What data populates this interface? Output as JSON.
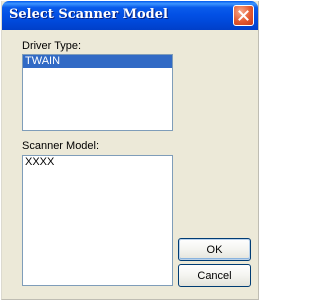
{
  "window": {
    "title": "Select Scanner Model"
  },
  "driver_type": {
    "label": "Driver Type:",
    "items": [
      "TWAIN"
    ],
    "selected_index": 0
  },
  "scanner_model": {
    "label": "Scanner Model:",
    "items": [
      "XXXX"
    ]
  },
  "buttons": {
    "ok_label": "OK",
    "cancel_label": "Cancel"
  },
  "icons": {
    "close": "close-icon"
  },
  "colors": {
    "titlebar": "#0A5CEB",
    "selection": "#316AC5",
    "close_button": "#E35A30",
    "dialog_background": "#ECE9D8"
  }
}
